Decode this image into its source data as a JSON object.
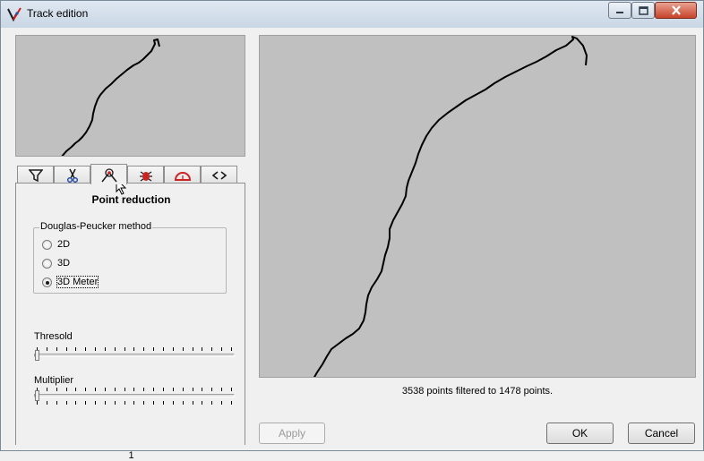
{
  "window": {
    "title": "Track edition"
  },
  "colors": {
    "track": "#000000",
    "preview_bg": "#c0c0c0",
    "tab_icon_red": "#cc2222",
    "tab_icon_blue": "#2a4fa8"
  },
  "tabs": [
    {
      "icon": "filter-funnel-icon"
    },
    {
      "icon": "scissors-icon"
    },
    {
      "icon": "point-reduction-icon",
      "active": true
    },
    {
      "icon": "bug-icon"
    },
    {
      "icon": "protractor-icon"
    },
    {
      "icon": "angle-brackets-icon"
    }
  ],
  "panel": {
    "title": "Point reduction",
    "group_label": "Douglas-Peucker method",
    "options": [
      {
        "label": "2D",
        "checked": false
      },
      {
        "label": "3D",
        "checked": false
      },
      {
        "label": "3D Meter",
        "checked": true
      }
    ],
    "threshold_label": "Thresold",
    "threshold_level": 0,
    "multiplier_label": "Multiplier",
    "multiplier_level": 0,
    "multiplier_value": "1"
  },
  "status_text": "3538 points filtered to 1478 points.",
  "buttons": {
    "apply": "Apply",
    "ok": "OK",
    "cancel": "Cancel"
  }
}
